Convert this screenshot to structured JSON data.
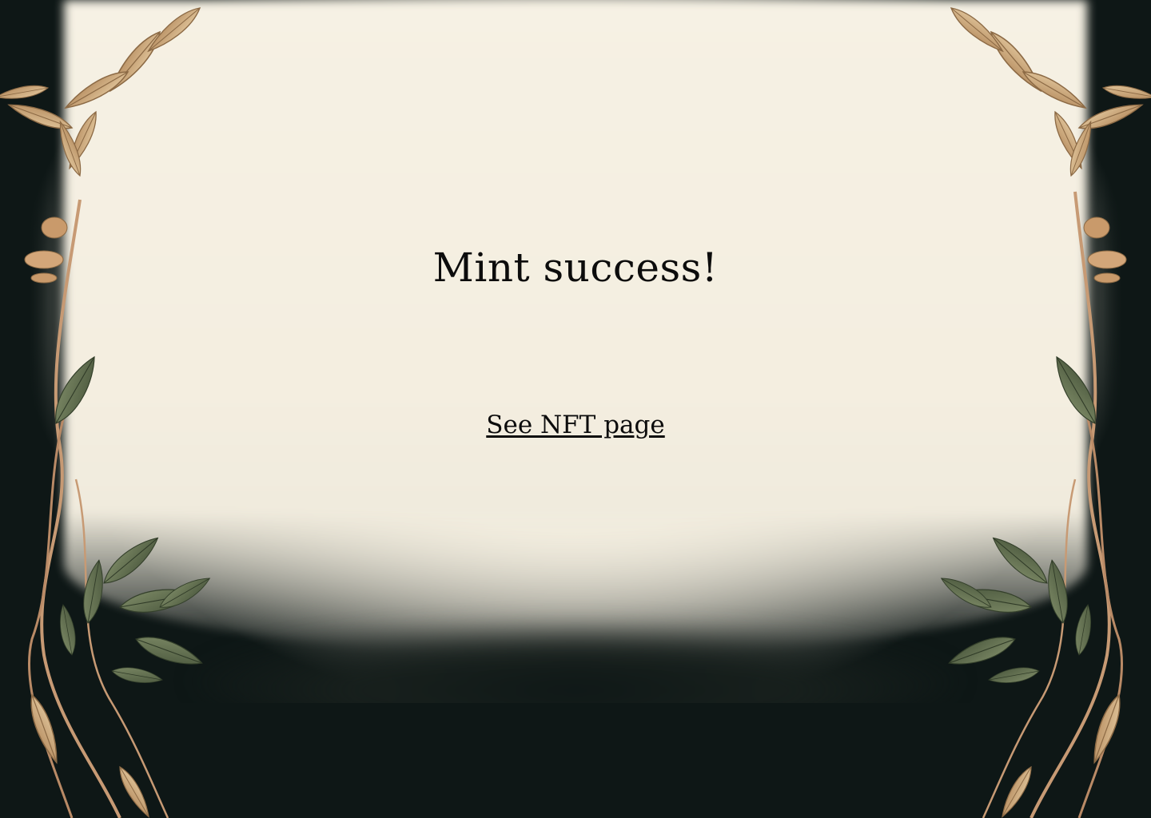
{
  "page": {
    "title": "Mint success!",
    "link_label": "See NFT page"
  },
  "theme": {
    "background_dark": "#0e1716",
    "parchment": "#f4eee0",
    "text": "#0c0c0c",
    "leaf_green": "#5c6b4c",
    "leaf_tan": "#cdaa7d",
    "vine": "#c79a74"
  },
  "decor": {
    "frame": "botanical-vine-frame"
  }
}
